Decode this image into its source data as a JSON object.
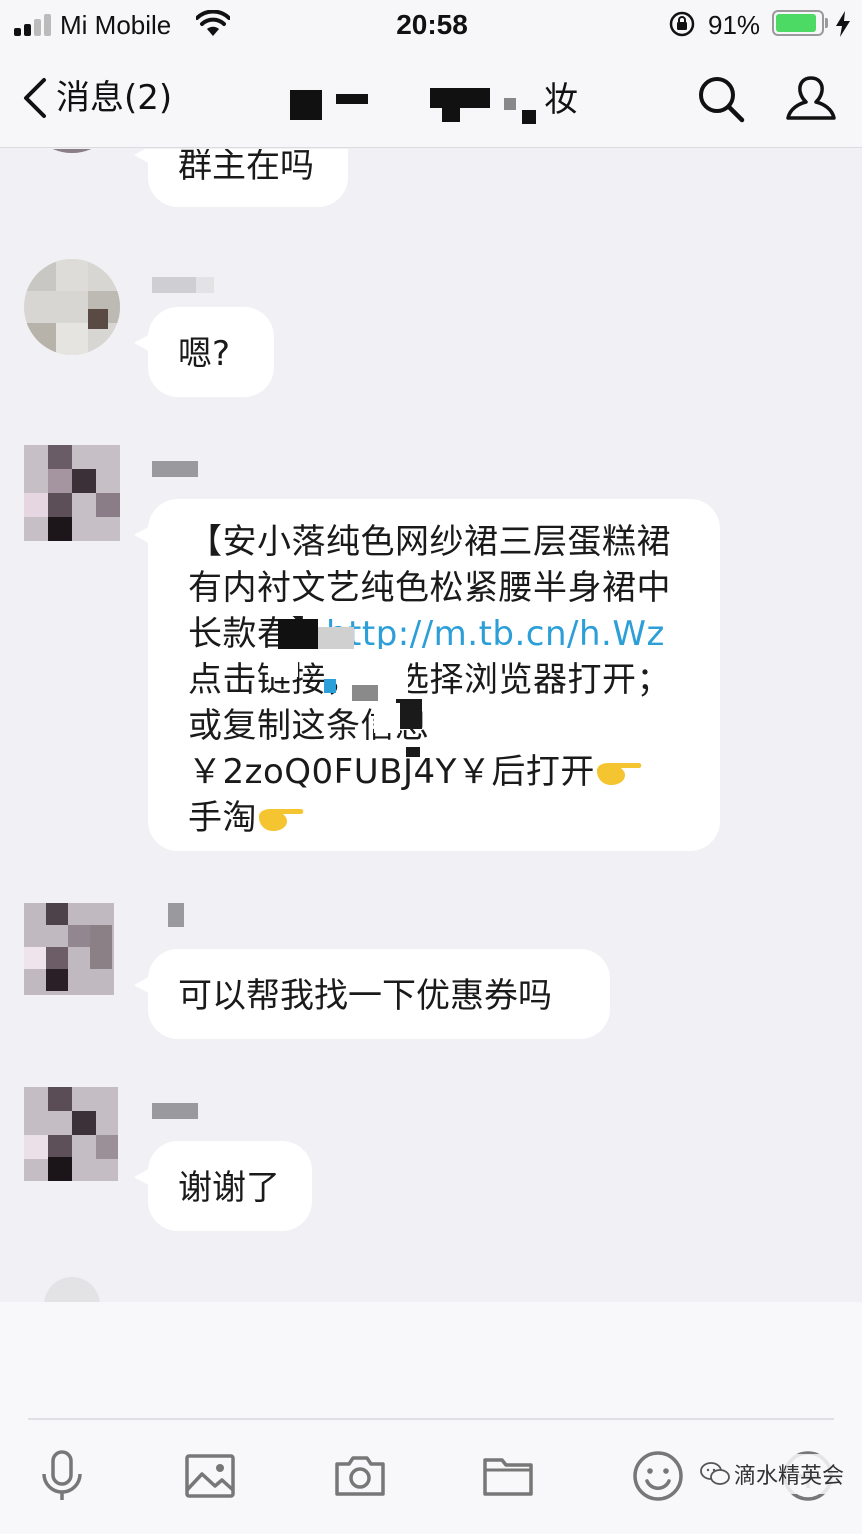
{
  "status_bar": {
    "carrier": "Mi Mobile",
    "time": "20:58",
    "battery_percent": "91%",
    "battery_level": 0.91,
    "icons": [
      "signal-icon",
      "wifi-icon",
      "rotation-lock-icon",
      "battery-icon",
      "charging-icon"
    ]
  },
  "nav": {
    "back_label": "消息(2)",
    "title_visible_char": "妆",
    "icons": [
      "back-chevron-icon",
      "search-icon",
      "contact-icon"
    ]
  },
  "messages": [
    {
      "text": "群主在吗"
    },
    {
      "text": "嗯?"
    },
    {
      "part1": "【安小落纯色网纱裙三层蛋糕裙有内衬文艺纯色松紧腰半身裙中长款春】",
      "link": "http://m.tb.cn/h.Wz",
      "part2": "点击链接，再选择浏览器打开；或复制这条信息￥2zoQ0FUBJ4Y￥后打开",
      "part3": "手淘",
      "emoji": "pointing-hand-emoji"
    },
    {
      "text": "可以帮我找一下优惠券吗"
    },
    {
      "text": "谢谢了"
    }
  ],
  "toolbar": {
    "icons": [
      "microphone-icon",
      "image-icon",
      "camera-icon",
      "folder-icon",
      "smiley-icon",
      "add-icon"
    ]
  },
  "watermark": {
    "text": "滴水精英会",
    "icon": "wechat-icon"
  },
  "colors": {
    "background": "#f1f1f5",
    "bubble": "#ffffff",
    "link": "#2d9fd8",
    "battery": "#4cd964"
  }
}
